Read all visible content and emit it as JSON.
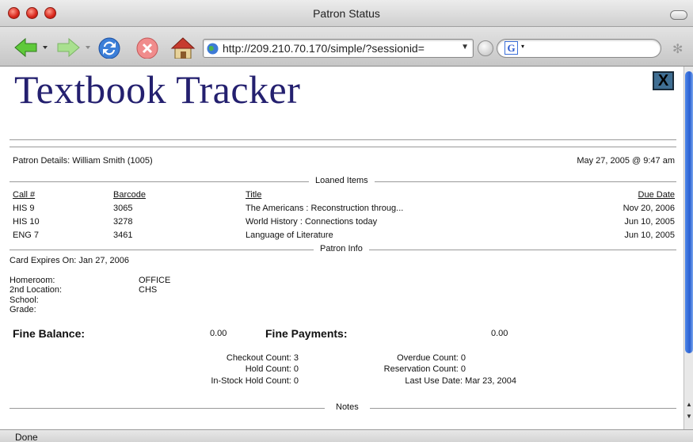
{
  "window": {
    "title": "Patron Status"
  },
  "toolbar": {
    "url": "http://209.210.70.170/simple/?sessionid=",
    "search_engine_letter": "G"
  },
  "page": {
    "logo_text": "Textbook Tracker",
    "close_label": "X",
    "patron_details": "Patron Details: William Smith (1005)",
    "timestamp": "May 27, 2005 @ 9:47 am",
    "sections": {
      "loaned": "Loaned Items",
      "patron_info": "Patron Info",
      "notes": "Notes"
    },
    "loans": {
      "headers": {
        "call": "Call #",
        "barcode": "Barcode",
        "title": "Title",
        "due": "Due Date"
      },
      "rows": [
        {
          "call": "HIS 9",
          "barcode": "3065",
          "title": "The Americans : Reconstruction throug...",
          "due": "Nov 20, 2006"
        },
        {
          "call": "HIS 10",
          "barcode": "3278",
          "title": "World History : Connections today",
          "due": "Jun 10, 2005"
        },
        {
          "call": "ENG 7",
          "barcode": "3461",
          "title": "Language of Literature",
          "due": "Jun 10, 2005"
        }
      ]
    },
    "card_expires": "Card Expires On: Jan 27, 2006",
    "info_labels": {
      "homeroom": "Homeroom:",
      "second_location": "2nd Location:",
      "school": "School:",
      "grade": "Grade:"
    },
    "info_values": {
      "homeroom": "OFFICE",
      "second_location": "CHS"
    },
    "fines": {
      "balance_label": "Fine Balance:",
      "balance_value": "0.00",
      "payments_label": "Fine Payments:",
      "payments_value": "0.00"
    },
    "counts": {
      "checkout": "Checkout Count: 3",
      "hold": "Hold Count: 0",
      "instock_hold": "In-Stock Hold Count: 0",
      "overdue": "Overdue Count: 0",
      "reservation": "Reservation Count: 0",
      "last_use": "Last Use Date: Mar 23, 2004"
    }
  },
  "status_bar": {
    "text": "Done"
  }
}
